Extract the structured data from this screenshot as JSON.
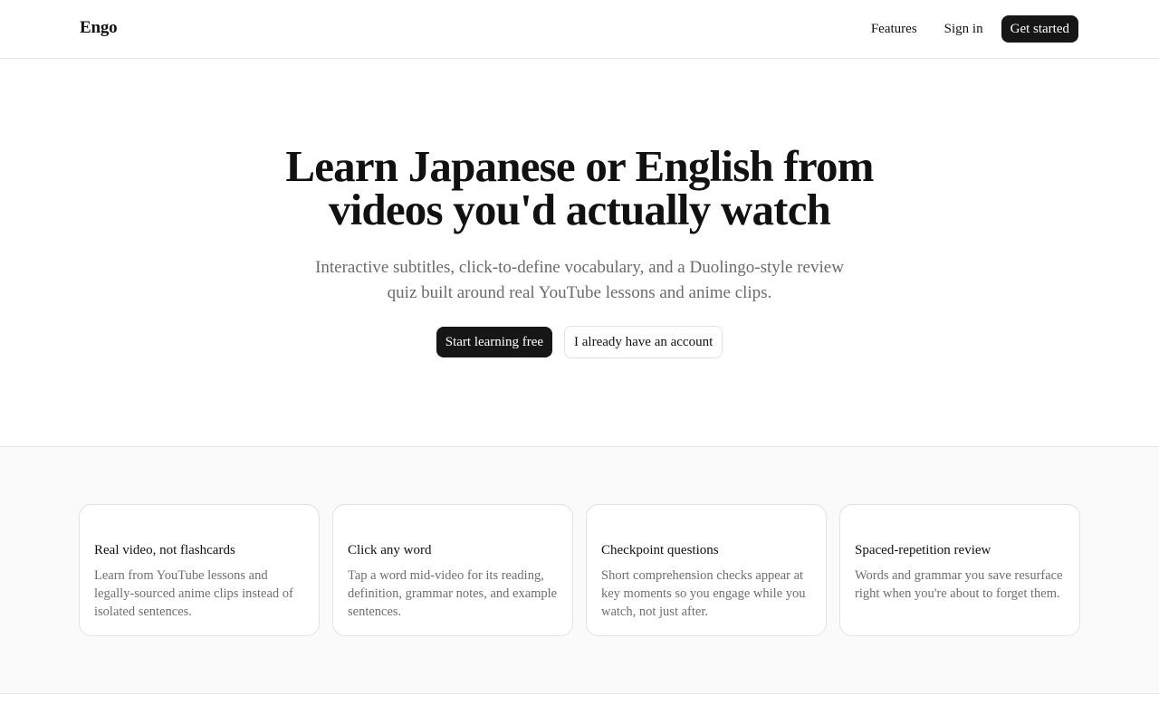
{
  "header": {
    "brand": "Engo",
    "nav": {
      "features": "Features",
      "sign_in": "Sign in",
      "get_started": "Get started"
    }
  },
  "hero": {
    "title_line_1": "Learn Japanese or English from",
    "title_line_2": "videos you'd actually watch",
    "subtitle_line_1": "Interactive subtitles, click-to-define vocabulary, and a Duolingo-style review",
    "subtitle_line_2": "quiz built around real YouTube lessons and anime clips.",
    "primary_cta": "Start learning free",
    "secondary_cta": "I already have an account"
  },
  "features": {
    "cards": [
      {
        "title": "Real video, not flashcards",
        "description": "Learn from YouTube lessons and legally-sourced anime clips instead of isolated sentences."
      },
      {
        "title": "Click any word",
        "description": "Tap a word mid-video for its reading, definition, grammar notes, and example sentences."
      },
      {
        "title": "Checkpoint questions",
        "description": "Short comprehension checks appear at key moments so you engage while you watch, not just after."
      },
      {
        "title": "Spaced-repetition review",
        "description": "Words and grammar you save resurface right when you're about to forget them."
      }
    ]
  },
  "colors": {
    "primary_button": "#161616",
    "text": "#111111",
    "muted_text": "#6b6b6b",
    "section_background": "#fafafa",
    "border": "#e5e5e5"
  }
}
